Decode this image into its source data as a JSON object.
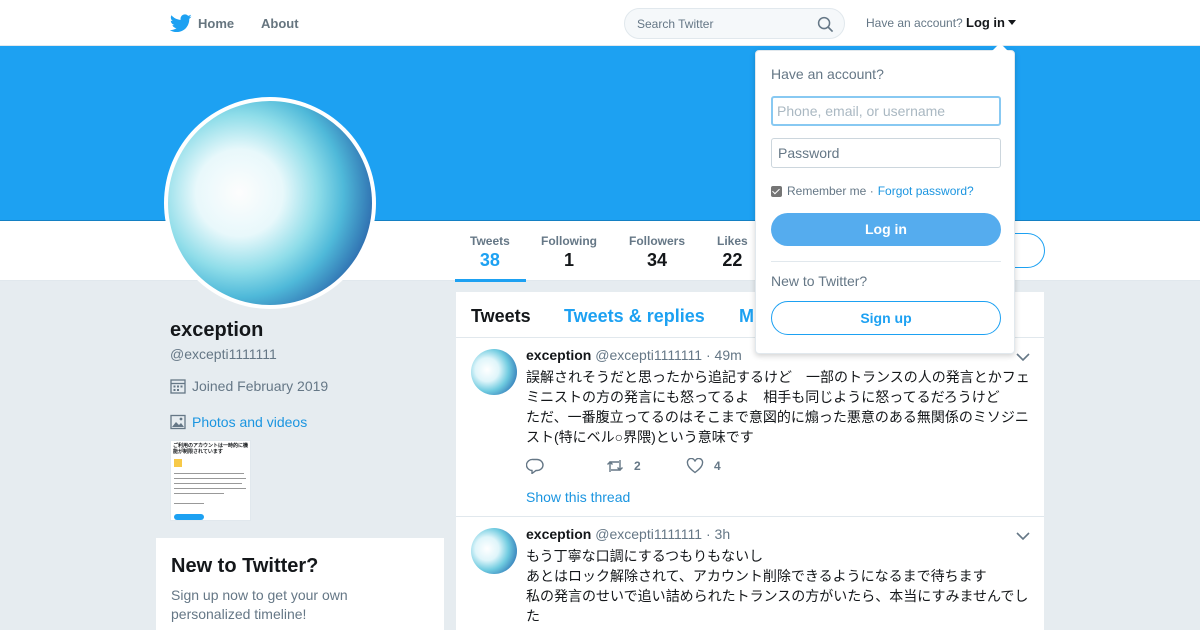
{
  "nav": {
    "home_label": "Home",
    "about_label": "About",
    "search_placeholder": "Search Twitter",
    "have_account": "Have an account?",
    "login_label": "Log in"
  },
  "colors": {
    "accent": "#1da1f2",
    "banner": "#1da1f2",
    "page_bg": "#e6ecf0"
  },
  "profile": {
    "name": "exception",
    "handle": "@excepti1111111",
    "joined": "Joined February 2019",
    "photos_label": "Photos and videos",
    "stats": [
      {
        "label": "Tweets",
        "value": "38"
      },
      {
        "label": "Following",
        "value": "1"
      },
      {
        "label": "Followers",
        "value": "34"
      },
      {
        "label": "Likes",
        "value": "22"
      }
    ]
  },
  "thumbnail": {
    "title": "ご利用のアカウントは一時的に機能が制限されています"
  },
  "new_to_twitter": {
    "title": "New to Twitter?",
    "text": "Sign up now to get your own personalized timeline!"
  },
  "timeline": {
    "tabs": [
      "Tweets",
      "Tweets & replies",
      "M"
    ],
    "tweets": [
      {
        "name": "exception",
        "handle": "@excepti1111111",
        "time": "· 49m",
        "text_lines": [
          "誤解されそうだと思ったから追記するけど　一部のトランスの人の発言とかフェ",
          "ミニストの方の発言にも怒ってるよ　相手も同じように怒ってるだろうけど",
          "ただ、一番腹立ってるのはそこまで意図的に煽った悪意のある無関係のミソジニ",
          "スト(特にベル○界隈)という意味です"
        ],
        "retweets": "2",
        "likes": "4",
        "thread_link": "Show this thread"
      },
      {
        "name": "exception",
        "handle": "@excepti1111111",
        "time": "· 3h",
        "text_lines": [
          "もう丁寧な口調にするつもりもないし",
          "あとはロック解除されて、アカウント削除できるようになるまで待ちます",
          "私の発言のせいで追い詰められたトランスの方がいたら、本当にすみませんでし",
          "た"
        ]
      }
    ]
  },
  "login_dropdown": {
    "title": "Have an account?",
    "username_placeholder": "Phone, email, or username",
    "password_placeholder": "Password",
    "remember_label": "Remember me ·",
    "forgot_label": "Forgot password?",
    "login_button": "Log in",
    "new_label": "New to Twitter?",
    "signup_button": "Sign up"
  }
}
